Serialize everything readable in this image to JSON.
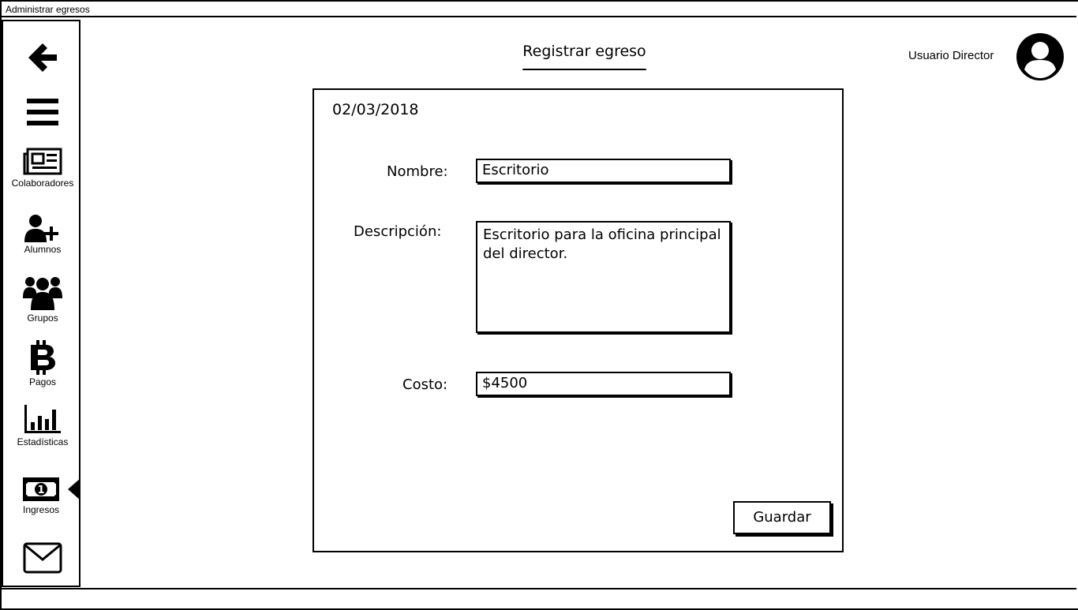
{
  "window": {
    "title": "Administrar egresos"
  },
  "sidebar": {
    "items": [
      {
        "icon": "back-arrow-icon",
        "label": ""
      },
      {
        "icon": "menu-icon",
        "label": ""
      },
      {
        "icon": "newspaper-icon",
        "label": "Colaboradores"
      },
      {
        "icon": "user-plus-icon",
        "label": "Alumnos"
      },
      {
        "icon": "users-icon",
        "label": "Grupos"
      },
      {
        "icon": "bitcoin-icon",
        "label": "Pagos"
      },
      {
        "icon": "bar-chart-icon",
        "label": "Estadísticas"
      },
      {
        "icon": "money-icon",
        "label": "Ingresos"
      },
      {
        "icon": "envelope-icon",
        "label": ""
      }
    ],
    "active": "Ingresos"
  },
  "header": {
    "title": "Registrar egreso",
    "user": "Usuario Director",
    "avatar_icon": "user-circle-icon"
  },
  "form": {
    "date": "02/03/2018",
    "nombre_label": "Nombre:",
    "nombre_value": "Escritorio",
    "descripcion_label": "Descripción:",
    "descripcion_value": "Escritorio para la oficina principal del director.",
    "costo_label": "Costo:",
    "costo_value": "$4500",
    "save_label": "Guardar"
  }
}
